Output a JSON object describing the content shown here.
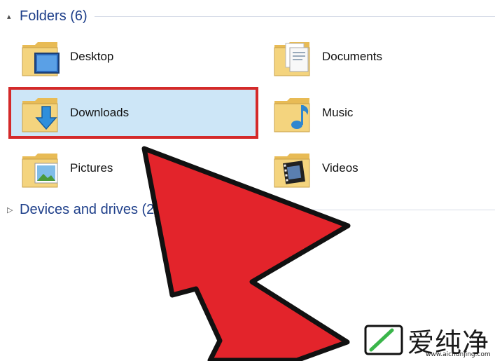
{
  "folders_group": {
    "collapse_glyph": "▴",
    "title": "Folders (6)"
  },
  "folders": [
    {
      "label": "Desktop",
      "icon": "desktop-folder-icon"
    },
    {
      "label": "Documents",
      "icon": "documents-folder-icon"
    },
    {
      "label": "Downloads",
      "icon": "downloads-folder-icon",
      "selected": true
    },
    {
      "label": "Music",
      "icon": "music-folder-icon"
    },
    {
      "label": "Pictures",
      "icon": "pictures-folder-icon"
    },
    {
      "label": "Videos",
      "icon": "videos-folder-icon"
    }
  ],
  "devices_group": {
    "collapse_glyph": "▷",
    "title": "Devices and drives (2)"
  },
  "watermark": {
    "brand": "爱纯净",
    "url": "www.aichunjing.com"
  },
  "colors": {
    "header_text": "#1e3f8a",
    "selection_bg": "#cde6f7",
    "highlight_border": "#d42a2a",
    "arrow_fill": "#e3242b",
    "folder_tan": "#f2cf74"
  }
}
